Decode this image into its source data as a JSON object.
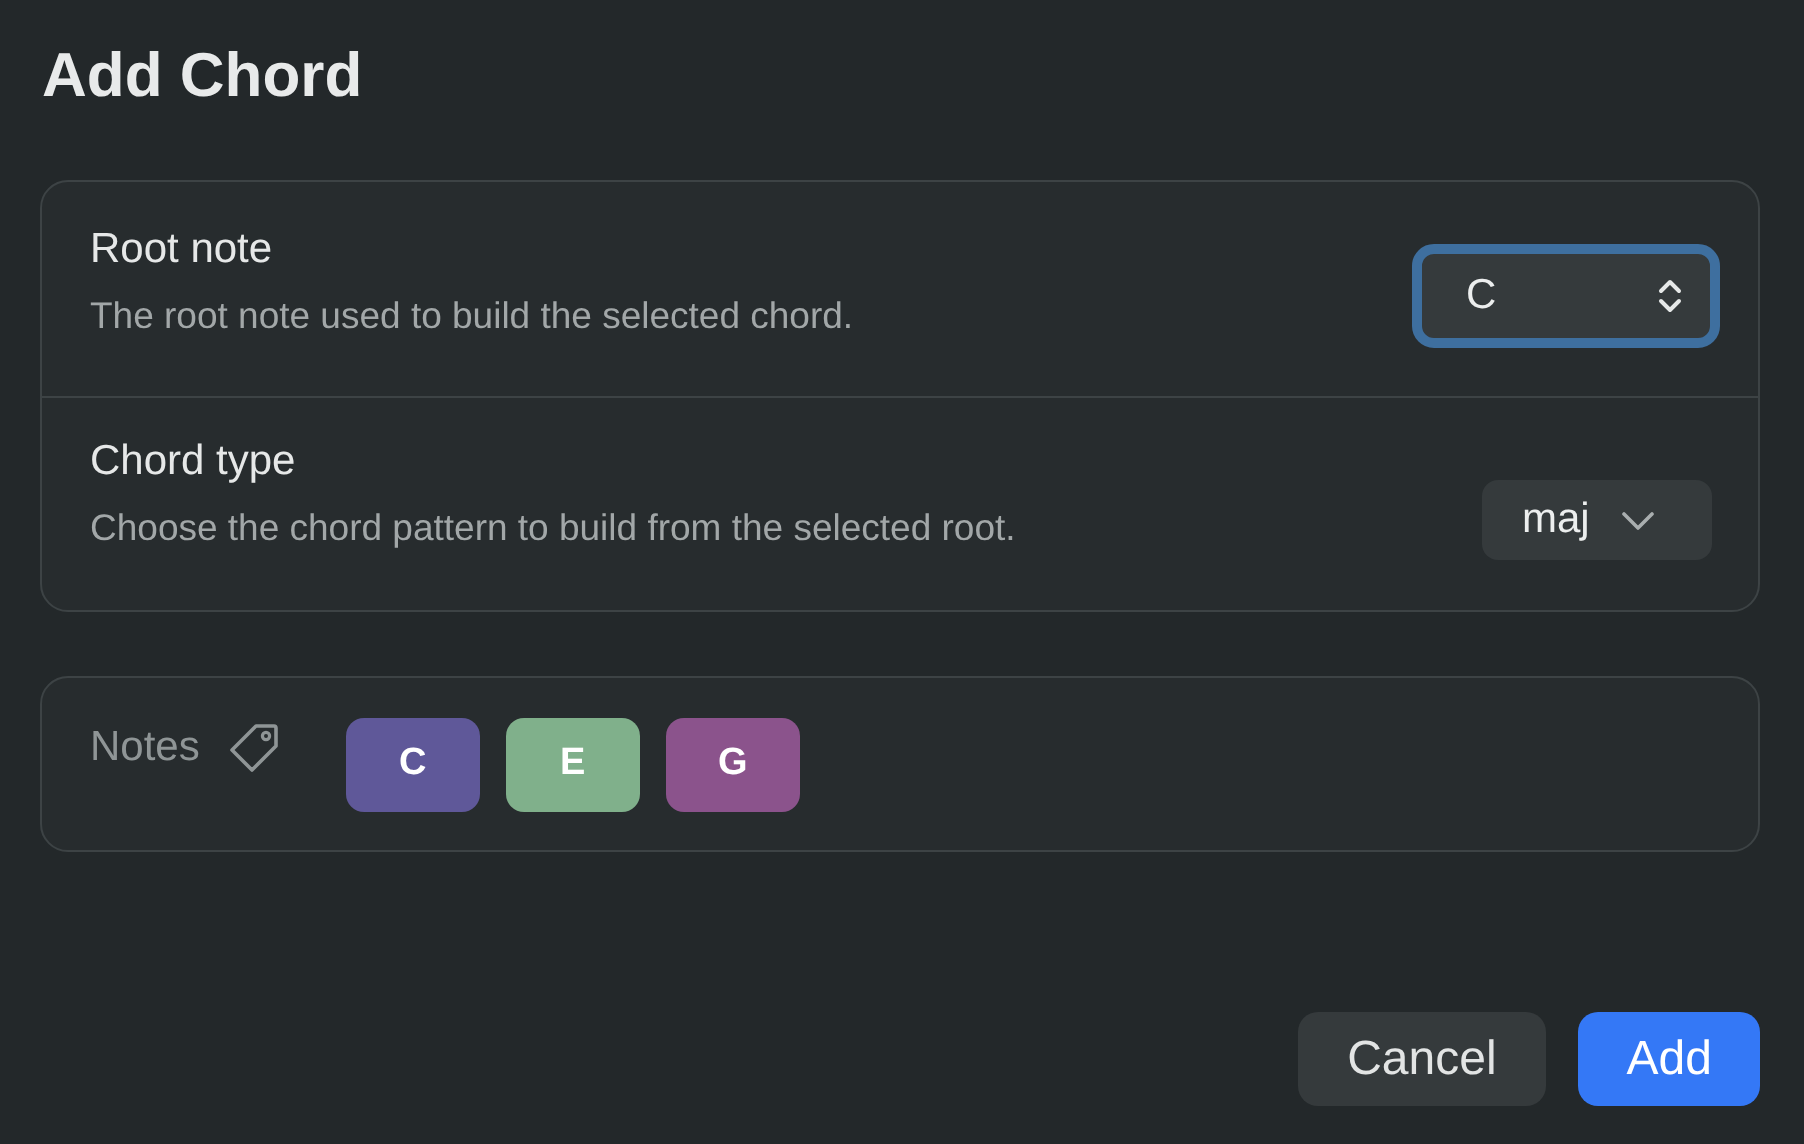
{
  "title": "Add Chord",
  "settings": [
    {
      "kind": "stepper",
      "label": "Root note",
      "description": "The root note used to build the selected chord.",
      "value": "C",
      "focused": true
    },
    {
      "kind": "dropdown",
      "label": "Chord type",
      "description": "Choose the chord pattern to build from the selected root.",
      "value": "maj",
      "focused": false
    }
  ],
  "notes": {
    "label": "Notes",
    "items": [
      {
        "name": "C",
        "color": "#5f5899"
      },
      {
        "name": "E",
        "color": "#80b08b"
      },
      {
        "name": "G",
        "color": "#8b538c"
      }
    ]
  },
  "buttons": [
    {
      "label": "Cancel",
      "kind": "secondary"
    },
    {
      "label": "Add",
      "kind": "primary"
    }
  ]
}
